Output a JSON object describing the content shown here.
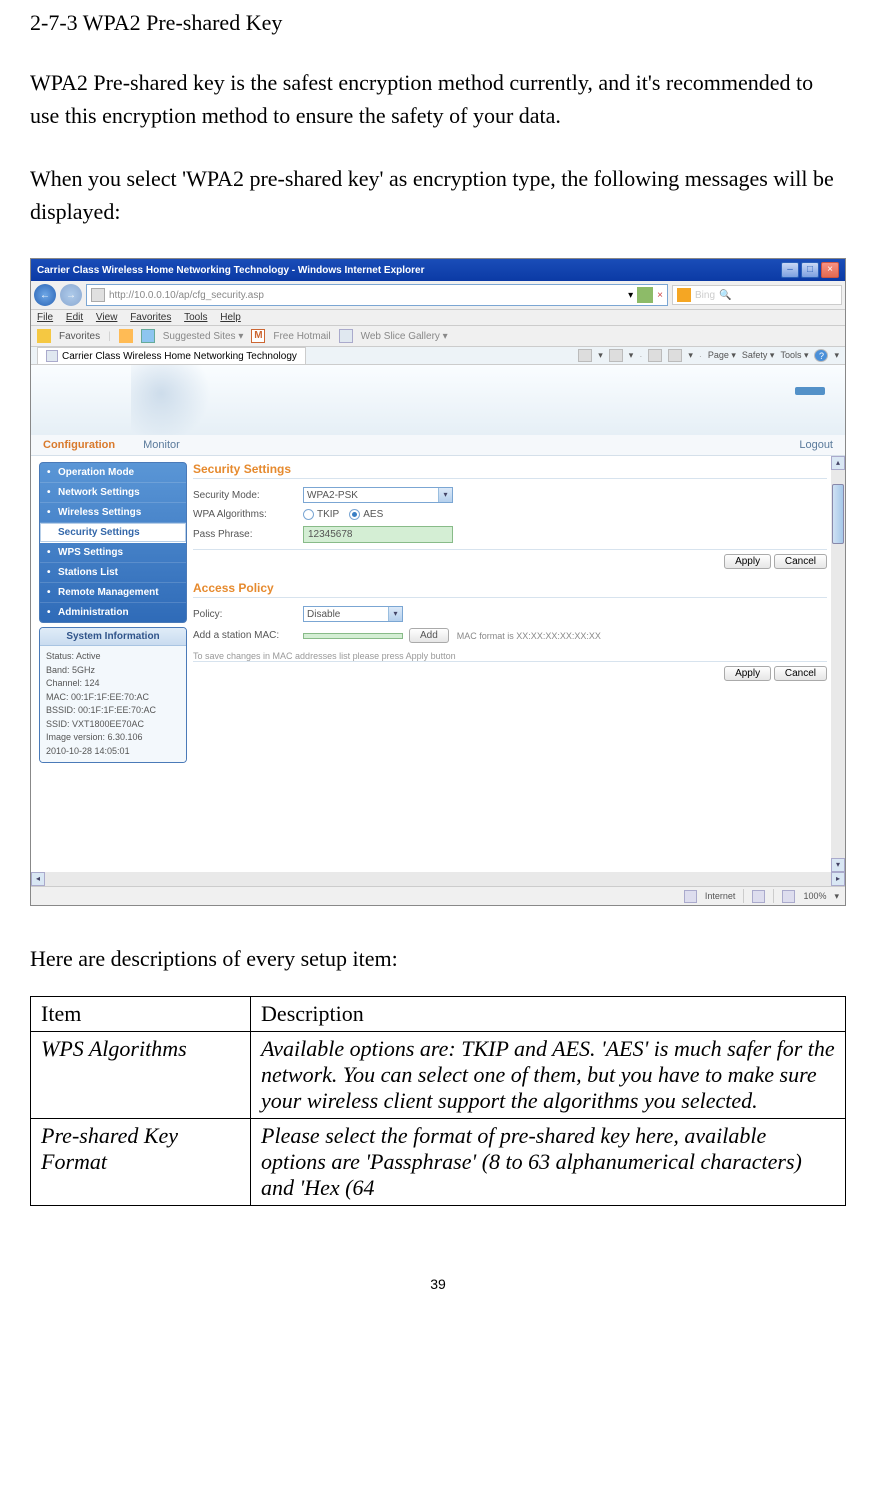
{
  "doc": {
    "heading": "2-7-3 WPA2 Pre-shared Key",
    "para1": "WPA2 Pre-shared key is the safest encryption method currently, and it's recommended to use this encryption method to ensure the safety of your data.",
    "para2": "When you select 'WPA2 pre-shared key' as encryption type, the following messages will be displayed:",
    "desc_intro": "Here are descriptions of every setup item:",
    "table": {
      "head_item": "Item",
      "head_desc": "Description",
      "rows": [
        {
          "item": "WPS Algorithms",
          "desc": "Available options are: TKIP and AES. 'AES' is much safer for the network. You can select one of them, but you have to make sure your wireless client support the algorithms you selected."
        },
        {
          "item": "Pre-shared Key Format",
          "desc": "Please select the format of pre-shared key here, available options are 'Passphrase' (8 to 63 alphanumerical characters) and 'Hex (64"
        }
      ]
    },
    "page_num": "39"
  },
  "ie": {
    "titlebar": "Carrier Class Wireless Home Networking Technology - Windows Internet Explorer",
    "win_min": "–",
    "win_max": "□",
    "win_close": "×",
    "nav_back": "←",
    "nav_fwd": "→",
    "address": "http://10.0.0.10/ap/cfg_security.asp",
    "addr_dropdown": "▾",
    "refresh": "↻",
    "stop": "×",
    "search_provider": "Bing",
    "search_mag": "🔍",
    "menu": [
      "File",
      "Edit",
      "View",
      "Favorites",
      "Tools",
      "Help"
    ],
    "fav_label": "Favorites",
    "fav_links": [
      "Suggested Sites ▾",
      "Free Hotmail",
      "Web Slice Gallery ▾"
    ],
    "tab_title": "Carrier Class Wireless Home Networking Technology",
    "tabtools": {
      "page": "Page ▾",
      "safety": "Safety ▾",
      "tools": "Tools ▾"
    },
    "navtabs": {
      "config": "Configuration",
      "monitor": "Monitor",
      "logout": "Logout"
    },
    "sidebar": {
      "items": [
        "Operation Mode",
        "Network Settings",
        "Wireless Settings",
        "Security Settings",
        "WPS Settings",
        "Stations List",
        "Remote Management",
        "Administration"
      ],
      "active_index": 3
    },
    "sysinfo": {
      "title": "System Information",
      "lines": [
        "Status: Active",
        "Band: 5GHz",
        "Channel: 124",
        "MAC: 00:1F:1F:EE:70:AC",
        "BSSID: 00:1F:1F:EE:70:AC",
        "SSID: VXT1800EE70AC",
        "Image version: 6.30.106",
        "2010-10-28 14:05:01"
      ]
    },
    "security": {
      "title": "Security Settings",
      "mode_label": "Security Mode:",
      "mode_value": "WPA2-PSK",
      "algo_label": "WPA Algorithms:",
      "algo_tkip": "TKIP",
      "algo_aes": "AES",
      "pass_label": "Pass Phrase:",
      "pass_value": "12345678",
      "apply": "Apply",
      "cancel": "Cancel"
    },
    "access": {
      "title": "Access Policy",
      "policy_label": "Policy:",
      "policy_value": "Disable",
      "mac_label": "Add a station MAC:",
      "mac_value": "",
      "add": "Add",
      "mac_note": "MAC format is XX:XX:XX:XX:XX:XX",
      "save_note": "To save changes in MAC addresses list please press Apply button",
      "apply": "Apply",
      "cancel": "Cancel"
    },
    "status": {
      "zone": "Internet",
      "mode_icon": "🛡",
      "zoom": "100%",
      "zoom_arrow": "▾"
    }
  }
}
